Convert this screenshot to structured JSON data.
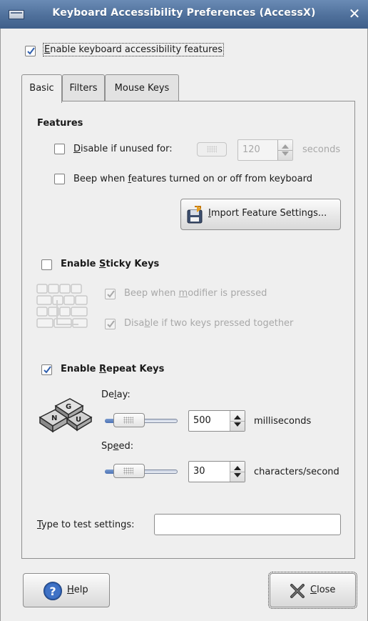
{
  "window": {
    "title": "Keyboard Accessibility Preferences (AccessX)",
    "close_glyph": "✕",
    "menu_icon": "window-menu-icon"
  },
  "enable_accessibility": {
    "label_pre": "",
    "label_mnemonic": "E",
    "label_post": "nable keyboard accessibility features",
    "checked": true
  },
  "tabs": [
    {
      "label": "Basic",
      "active": true
    },
    {
      "label": "Filters",
      "active": false
    },
    {
      "label": "Mouse Keys",
      "active": false
    }
  ],
  "features": {
    "title": "Features",
    "disable_unused": {
      "mnemonic": "D",
      "label_post": "isable if unused for:",
      "checked": false,
      "value": "120",
      "unit": "seconds"
    },
    "beep_features": {
      "label_pre": "Beep when ",
      "mnemonic": "f",
      "label_post": "eatures turned on or off from keyboard",
      "checked": false
    },
    "import_button": {
      "mnemonic": "I",
      "label_post": "mport Feature Settings...",
      "icon": "import-settings-icon"
    }
  },
  "sticky_keys": {
    "title_pre": "Enable ",
    "title_mnemonic": "S",
    "title_post": "ticky Keys",
    "checked": false,
    "icon": "sticky-keys-icon",
    "beep_modifier": {
      "label_pre": "Beep when ",
      "mnemonic": "m",
      "label_post": "odifier is pressed",
      "checked": true
    },
    "disable_two_keys": {
      "label_pre": "Disa",
      "mnemonic": "b",
      "label_post": "le if two keys pressed together",
      "checked": true
    }
  },
  "repeat_keys": {
    "title_pre": "Enable ",
    "title_mnemonic": "R",
    "title_post": "epeat Keys",
    "checked": true,
    "icon": "repeat-keys-icon",
    "delay": {
      "label_pre": "De",
      "mnemonic": "l",
      "label_post": "ay:",
      "value": "500",
      "unit": "milliseconds",
      "level": 0.25
    },
    "speed": {
      "label_pre": "Sp",
      "mnemonic": "e",
      "label_post": "ed:",
      "value": "30",
      "unit": "characters/second",
      "level": 0.25
    }
  },
  "test": {
    "mnemonic": "T",
    "label_post": "ype to test settings:",
    "value": ""
  },
  "buttons": {
    "help": {
      "mnemonic": "H",
      "label_post": "elp",
      "icon": "help-icon"
    },
    "close": {
      "mnemonic": "C",
      "label_post": "lose",
      "icon": "close-icon"
    }
  },
  "colors": {
    "titlebar": "#4f709b",
    "window_bg": "#efefef",
    "slider_fill": "#4c72b5",
    "help_icon": "#2f5fae"
  }
}
